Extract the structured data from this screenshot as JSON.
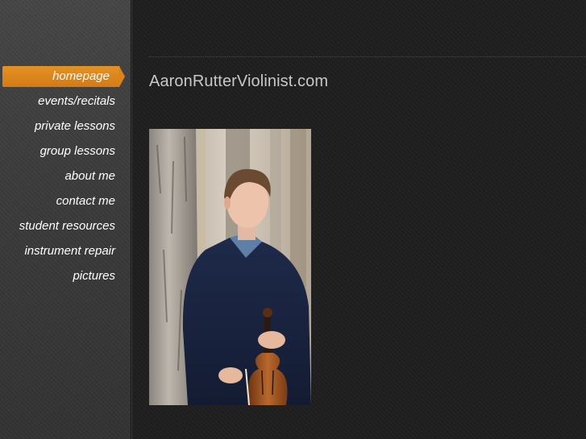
{
  "site": {
    "title": "AaronRutterViolinist.com"
  },
  "nav": {
    "items": [
      {
        "label": "homepage",
        "active": true
      },
      {
        "label": "events/recitals",
        "active": false
      },
      {
        "label": "private lessons",
        "active": false
      },
      {
        "label": "group lessons",
        "active": false
      },
      {
        "label": "about me",
        "active": false
      },
      {
        "label": "contact me",
        "active": false
      },
      {
        "label": "student resources",
        "active": false
      },
      {
        "label": "instrument repair",
        "active": false
      },
      {
        "label": "pictures",
        "active": false
      }
    ]
  },
  "colors": {
    "accent": "#d9831b",
    "background": "#1f1f1f",
    "sidebar": "#3c3c3c",
    "title_text": "#c8c8c8"
  }
}
